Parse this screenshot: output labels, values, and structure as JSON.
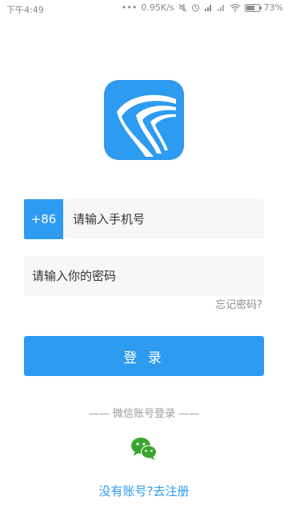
{
  "status_bar": {
    "time": "下午4:49",
    "network_speed": "0.95K/s",
    "battery_percent": "73%",
    "battery_level": 0.73,
    "icons": [
      "dots-icon",
      "mute-icon",
      "alarm-icon",
      "signal-icon",
      "signal-icon",
      "wifi-icon",
      "battery-icon"
    ]
  },
  "app": {
    "logo": "app-logo-icon",
    "brand_color": "#2d9bf0"
  },
  "form": {
    "country_code": "+86",
    "phone_placeholder": "请输入手机号",
    "password_placeholder": "请输入你的密码",
    "forgot_password": "忘记密码?",
    "login_button": "登 录"
  },
  "social": {
    "label": "—— 微信账号登录 ——",
    "icon": "wechat-icon",
    "icon_color": "#3aa52d"
  },
  "register_link": "没有账号?去注册"
}
